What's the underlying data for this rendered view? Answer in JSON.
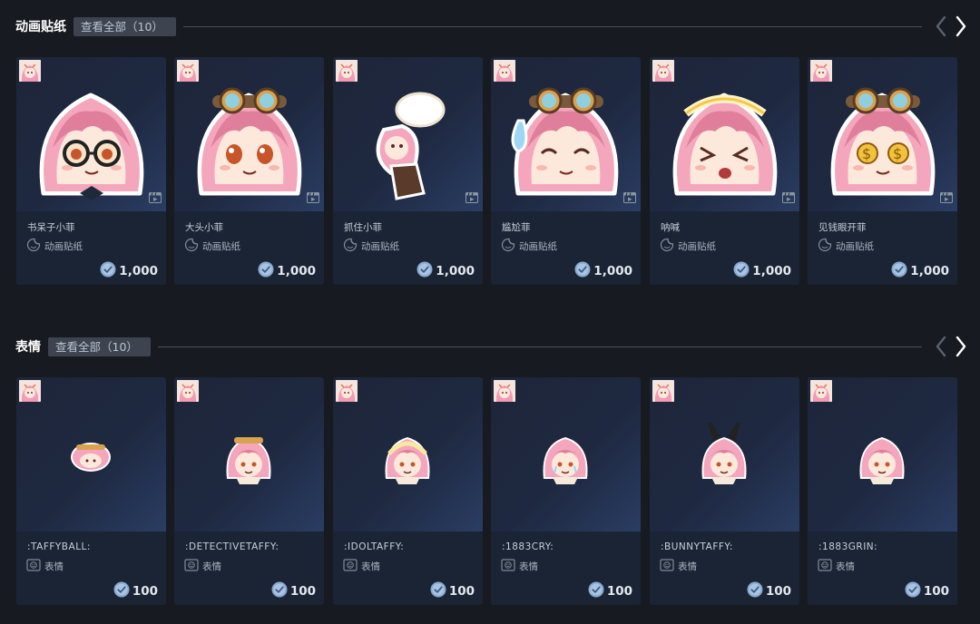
{
  "sections": [
    {
      "title": "动画贴纸",
      "view_all": "查看全部（10）",
      "items": [
        {
          "name": "书呆子小菲",
          "type": "动画贴纸",
          "price": "1,000"
        },
        {
          "name": "大头小菲",
          "type": "动画贴纸",
          "price": "1,000"
        },
        {
          "name": "抓住小菲",
          "type": "动画贴纸",
          "price": "1,000"
        },
        {
          "name": "尴尬菲",
          "type": "动画贴纸",
          "price": "1,000"
        },
        {
          "name": "呐喊",
          "type": "动画贴纸",
          "price": "1,000"
        },
        {
          "name": "见钱眼开菲",
          "type": "动画贴纸",
          "price": "1,000"
        }
      ]
    },
    {
      "title": "表情",
      "view_all": "查看全部（10）",
      "items": [
        {
          "name": ":TAFFYBALL:",
          "type": "表情",
          "price": "100"
        },
        {
          "name": ":DETECTIVETAFFY:",
          "type": "表情",
          "price": "100"
        },
        {
          "name": ":IDOLTAFFY:",
          "type": "表情",
          "price": "100"
        },
        {
          "name": ":1883CRY:",
          "type": "表情",
          "price": "100"
        },
        {
          "name": ":BUNNYTAFFY:",
          "type": "表情",
          "price": "100"
        },
        {
          "name": ":1883GRIN:",
          "type": "表情",
          "price": "100"
        }
      ]
    }
  ],
  "icons": {
    "nav_prev": "chevron-left-icon",
    "nav_next": "chevron-right-icon",
    "sticker_type": "sticker-icon",
    "emoticon_type": "emoticon-icon",
    "animated": "film-icon",
    "currency": "steam-points-coin-icon"
  },
  "colors": {
    "background": "#171a21",
    "card": "#1b2435",
    "view_all_bg": "#3d4450",
    "coin": "#8aa9cf",
    "hair": "#f4a6bd"
  }
}
